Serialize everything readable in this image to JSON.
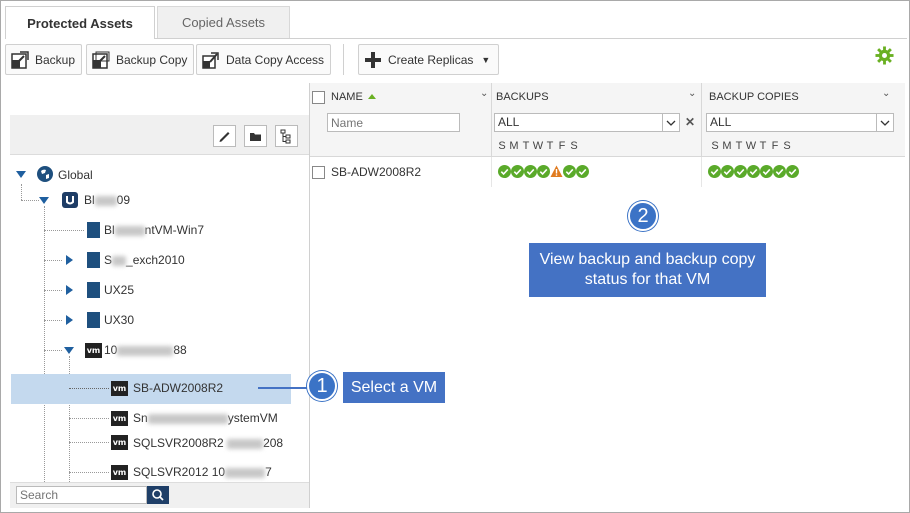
{
  "tabs": [
    {
      "label": "Protected Assets",
      "active": true
    },
    {
      "label": "Copied Assets",
      "active": false
    }
  ],
  "toolbar": {
    "backup_label": "Backup",
    "backup_copy_label": "Backup Copy",
    "data_copy_access_label": "Data Copy Access",
    "create_replicas_label": "Create Replicas",
    "settings_icon": "gear-icon"
  },
  "tree": {
    "root": "Global",
    "nodes": [
      {
        "label_prefix": "Bl",
        "label_suffix": "09",
        "type": "appliance"
      },
      {
        "label_prefix": "Bl",
        "label_suffix": "ntVM-Win7",
        "type": "server"
      },
      {
        "label_prefix": "S",
        "label_suffix": "_exch2010",
        "type": "server"
      },
      {
        "label": "UX25",
        "type": "server"
      },
      {
        "label": "UX30",
        "type": "server"
      },
      {
        "label_prefix": "10",
        "label_suffix": "88",
        "type": "vcenter"
      },
      {
        "label": "SB-ADW2008R2",
        "type": "vm",
        "selected": true
      },
      {
        "label_prefix": "Sn",
        "label_suffix": "ystemVM",
        "type": "vm"
      },
      {
        "label_prefix": "SQLSVR2008R2 ",
        "label_suffix": "208",
        "type": "vm"
      },
      {
        "label_prefix": "SQLSVR2012 10",
        "label_suffix": "7",
        "type": "vm"
      }
    ],
    "search_placeholder": "Search"
  },
  "grid": {
    "columns": {
      "name": "NAME",
      "backups": "BACKUPS",
      "backup_copies": "BACKUP COPIES"
    },
    "name_filter_placeholder": "Name",
    "backups_filter": "ALL",
    "copies_filter": "ALL",
    "days": [
      "S",
      "M",
      "T",
      "W",
      "T",
      "F",
      "S"
    ],
    "rows": [
      {
        "name": "SB-ADW2008R2",
        "backups": [
          "ok",
          "ok",
          "ok",
          "ok",
          "warning",
          "ok",
          "ok"
        ],
        "backup_copies": [
          "ok",
          "ok",
          "ok",
          "ok",
          "ok",
          "ok",
          "ok"
        ]
      }
    ]
  },
  "callouts": {
    "step1_number": "1",
    "step1_text": "Select a VM",
    "step2_number": "2",
    "step2_text_line1": "View backup and backup copy",
    "step2_text_line2": "status for that VM"
  },
  "colors": {
    "accent": "#4472c4",
    "ok": "#5aaa2a",
    "warning": "#e07b20",
    "selection": "#c4d9ee",
    "tree_icon": "#1e4f7e"
  }
}
